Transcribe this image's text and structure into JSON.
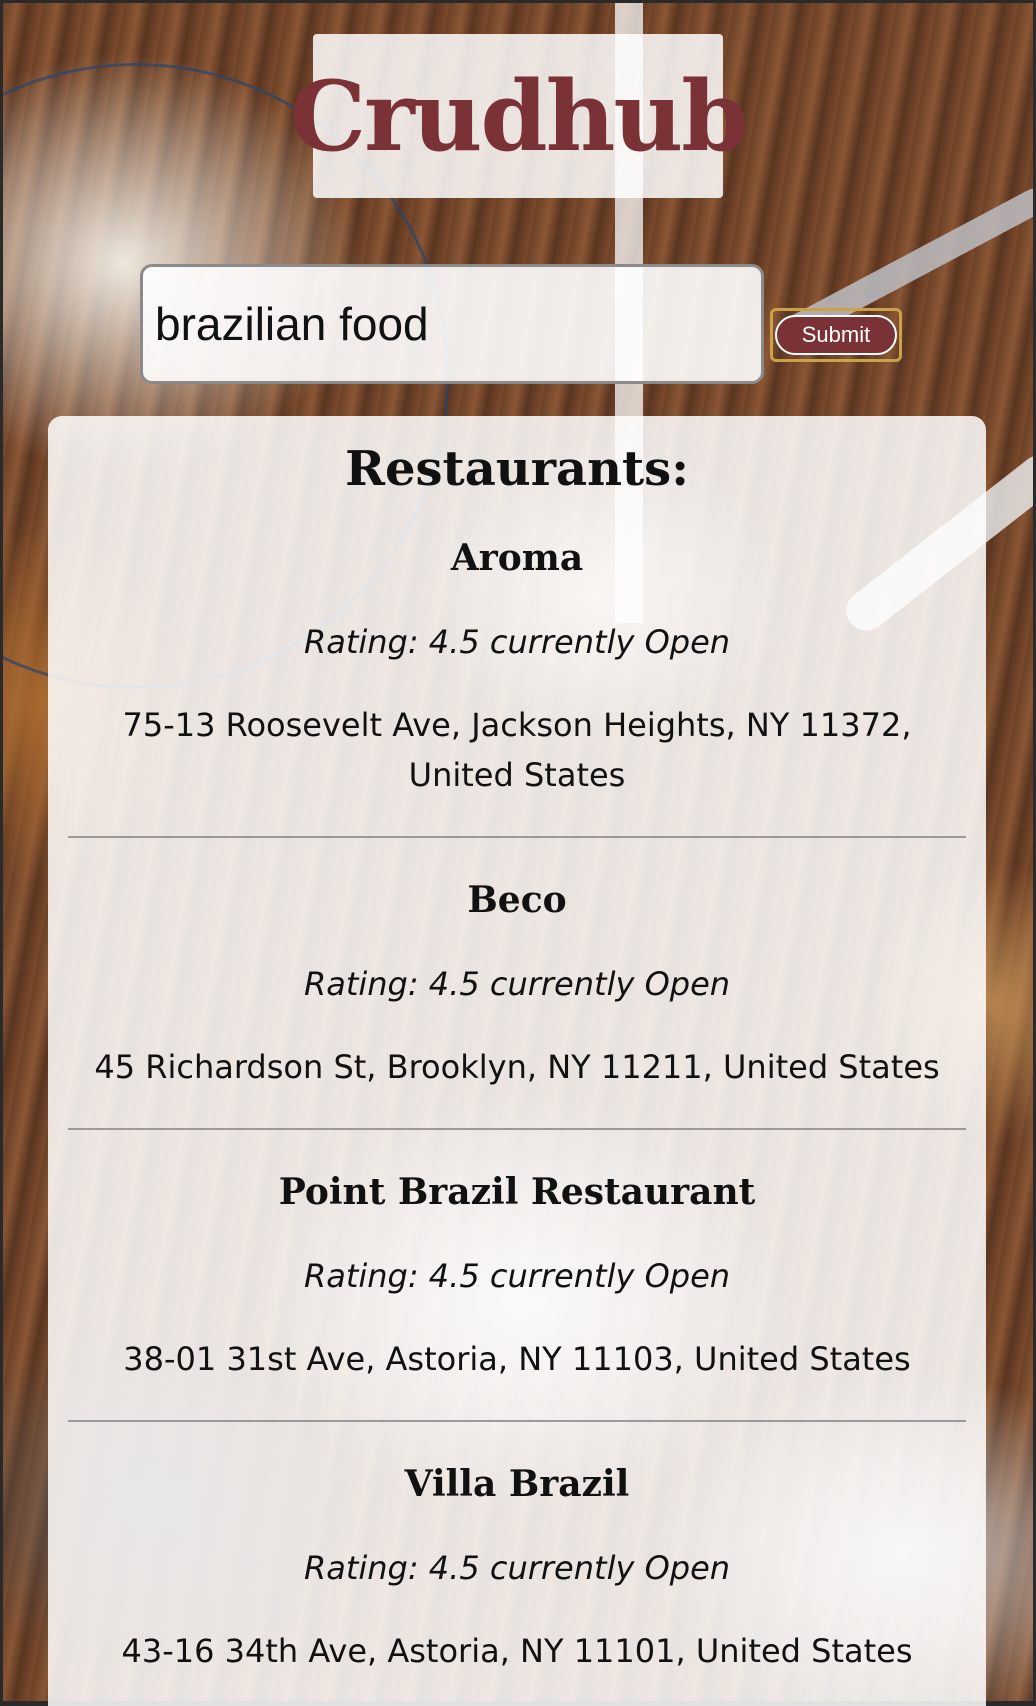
{
  "brand": {
    "title": "Crudhub",
    "color": "#7a3236"
  },
  "search": {
    "value": "brazilian food",
    "submit_label": "Submit"
  },
  "results": {
    "heading": "Restaurants:",
    "items": [
      {
        "name": "Aroma",
        "rating": "Rating: 4.5 currently Open",
        "address": "75-13 Roosevelt Ave, Jackson Heights, NY 11372, United States"
      },
      {
        "name": "Beco",
        "rating": "Rating: 4.5 currently Open",
        "address": "45 Richardson St, Brooklyn, NY 11211, United States"
      },
      {
        "name": "Point Brazil Restaurant",
        "rating": "Rating: 4.5 currently Open",
        "address": "38-01 31st Ave, Astoria, NY 11103, United States"
      },
      {
        "name": "Villa Brazil",
        "rating": "Rating: 4.5 currently Open",
        "address": "43-16 34th Ave, Astoria, NY 11101, United States"
      }
    ]
  }
}
